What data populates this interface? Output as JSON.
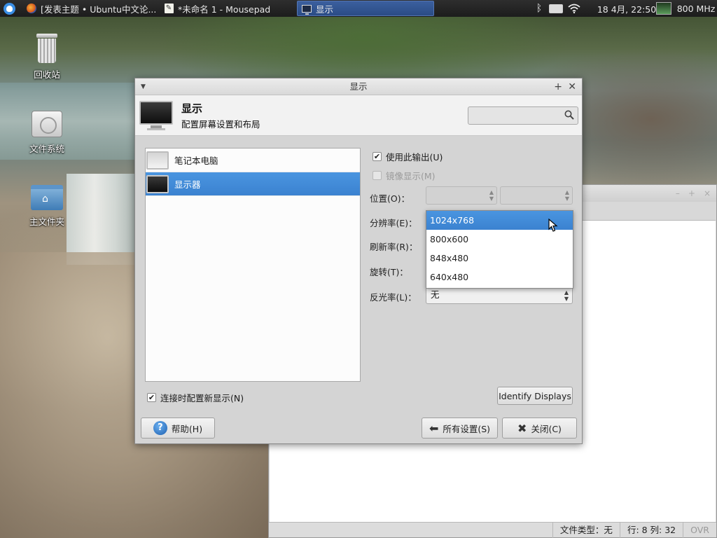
{
  "taskbar": {
    "tasks": [
      {
        "label": "[发表主题 • Ubuntu中文论...",
        "icon": "firefox-icon"
      },
      {
        "label": "*未命名 1 - Mousepad",
        "icon": "notepad-icon"
      },
      {
        "label": "显示",
        "icon": "display-icon",
        "active": true
      }
    ],
    "clock": "18 4月, 22:50",
    "cpu_freq": "800 MHz"
  },
  "desktop": {
    "icons": [
      {
        "label": "回收站",
        "icon": "trash-icon"
      },
      {
        "label": "文件系统",
        "icon": "drive-icon"
      },
      {
        "label": "主文件夹",
        "icon": "home-folder-icon"
      }
    ]
  },
  "background_window": {
    "status": {
      "filetype": "文件类型：无",
      "position": "行: 8 列: 32",
      "mode": "OVR"
    }
  },
  "dialog": {
    "title": "显示",
    "header_title": "显示",
    "header_subtitle": "配置屏幕设置和布局",
    "search_placeholder": "",
    "outputs": [
      {
        "label": "笔记本电脑",
        "selected": false
      },
      {
        "label": "显示器",
        "selected": true
      }
    ],
    "use_output": {
      "label": "使用此输出(U)",
      "checked": true
    },
    "mirror": {
      "label": "镜像显示(M)",
      "checked": false,
      "enabled": false
    },
    "fields": {
      "position": "位置(O)：",
      "resolution": "分辨率(E)：",
      "refresh": "刷新率(R)：",
      "rotation": "旋转(T)：",
      "reflection": "反光率(L)："
    },
    "reflection_value": "无",
    "resolution_options": [
      "1024x768",
      "800x600",
      "848x480",
      "640x480"
    ],
    "resolution_selected": "1024x768",
    "configure_on_connect": {
      "label": "连接时配置新显示(N)",
      "checked": true
    },
    "identify_button": "Identify Displays",
    "help_button": "帮助(H)",
    "all_settings_button": "所有设置(S)",
    "close_button": "关闭(C)"
  },
  "colors": {
    "selection": "#3b82d0",
    "panel": "#1c1c1c"
  }
}
